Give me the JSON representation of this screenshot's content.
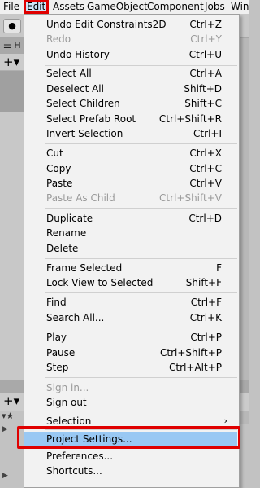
{
  "menubar": {
    "file": "File",
    "edit": "Edit",
    "assets": "Assets",
    "gameobject": "GameObject",
    "component": "Component",
    "jobs": "Jobs",
    "window": "Win"
  },
  "bg": {
    "tab1": "H",
    "tab2": "Ga"
  },
  "menu": {
    "undo": {
      "label": "Undo Edit Constraints2D",
      "shortcut": "Ctrl+Z"
    },
    "redo": {
      "label": "Redo",
      "shortcut": "Ctrl+Y"
    },
    "undo_history": {
      "label": "Undo History",
      "shortcut": "Ctrl+U"
    },
    "select_all": {
      "label": "Select All",
      "shortcut": "Ctrl+A"
    },
    "deselect_all": {
      "label": "Deselect All",
      "shortcut": "Shift+D"
    },
    "select_children": {
      "label": "Select Children",
      "shortcut": "Shift+C"
    },
    "select_prefab_root": {
      "label": "Select Prefab Root",
      "shortcut": "Ctrl+Shift+R"
    },
    "invert_selection": {
      "label": "Invert Selection",
      "shortcut": "Ctrl+I"
    },
    "cut": {
      "label": "Cut",
      "shortcut": "Ctrl+X"
    },
    "copy": {
      "label": "Copy",
      "shortcut": "Ctrl+C"
    },
    "paste": {
      "label": "Paste",
      "shortcut": "Ctrl+V"
    },
    "paste_as_child": {
      "label": "Paste As Child",
      "shortcut": "Ctrl+Shift+V"
    },
    "duplicate": {
      "label": "Duplicate",
      "shortcut": "Ctrl+D"
    },
    "rename": {
      "label": "Rename"
    },
    "delete": {
      "label": "Delete"
    },
    "frame_selected": {
      "label": "Frame Selected",
      "shortcut": "F"
    },
    "lock_view": {
      "label": "Lock View to Selected",
      "shortcut": "Shift+F"
    },
    "find": {
      "label": "Find",
      "shortcut": "Ctrl+F"
    },
    "search_all": {
      "label": "Search All...",
      "shortcut": "Ctrl+K"
    },
    "play": {
      "label": "Play",
      "shortcut": "Ctrl+P"
    },
    "pause": {
      "label": "Pause",
      "shortcut": "Ctrl+Shift+P"
    },
    "step": {
      "label": "Step",
      "shortcut": "Ctrl+Alt+P"
    },
    "sign_in": {
      "label": "Sign in..."
    },
    "sign_out": {
      "label": "Sign out"
    },
    "selection": {
      "label": "Selection"
    },
    "project_settings": {
      "label": "Project Settings..."
    },
    "preferences": {
      "label": "Preferences..."
    },
    "shortcuts": {
      "label": "Shortcuts..."
    }
  },
  "colors": {
    "highlight": "#99c8f3",
    "annotation": "#e00000",
    "menu_bg": "#f2f2f2",
    "disabled_text": "#9a9a9a"
  }
}
